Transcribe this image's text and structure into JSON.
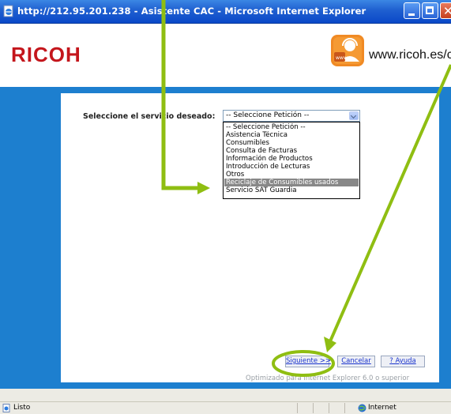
{
  "window": {
    "title": "http://212.95.201.238 - Asistente CAC - Microsoft Internet Explorer",
    "icon": "ie-page-icon",
    "controls": [
      "minimize-icon",
      "maximize-icon",
      "close-icon"
    ]
  },
  "header": {
    "logo": "RICOH",
    "site_url": "www.ricoh.es/cac",
    "brand_icon": "support-headset-icon"
  },
  "form": {
    "label": "Seleccione el servicio deseado:",
    "selected_value": "-- Seleccione Petición --",
    "options": [
      "-- Seleccione Petición --",
      "Asistencia Técnica",
      "Consumibles",
      "Consulta de Facturas",
      "Información de Productos",
      "Introducción de Lecturas",
      "Otros",
      "Reciclaje de Consumibles usados",
      "Servicio SAT Guardia"
    ],
    "highlighted_option": "Reciclaje de Consumibles usados"
  },
  "buttons": {
    "next": "Siguiente >>",
    "cancel": "Cancelar",
    "help": "? Ayuda"
  },
  "footer_note": "Optimizado para Internet Explorer 6.0 o superior",
  "status": {
    "text": "Listo",
    "zone": "Internet"
  },
  "colors": {
    "brand_red": "#c4161c",
    "frame_blue": "#1d7fcf",
    "annotation_green": "#8fbe12"
  }
}
